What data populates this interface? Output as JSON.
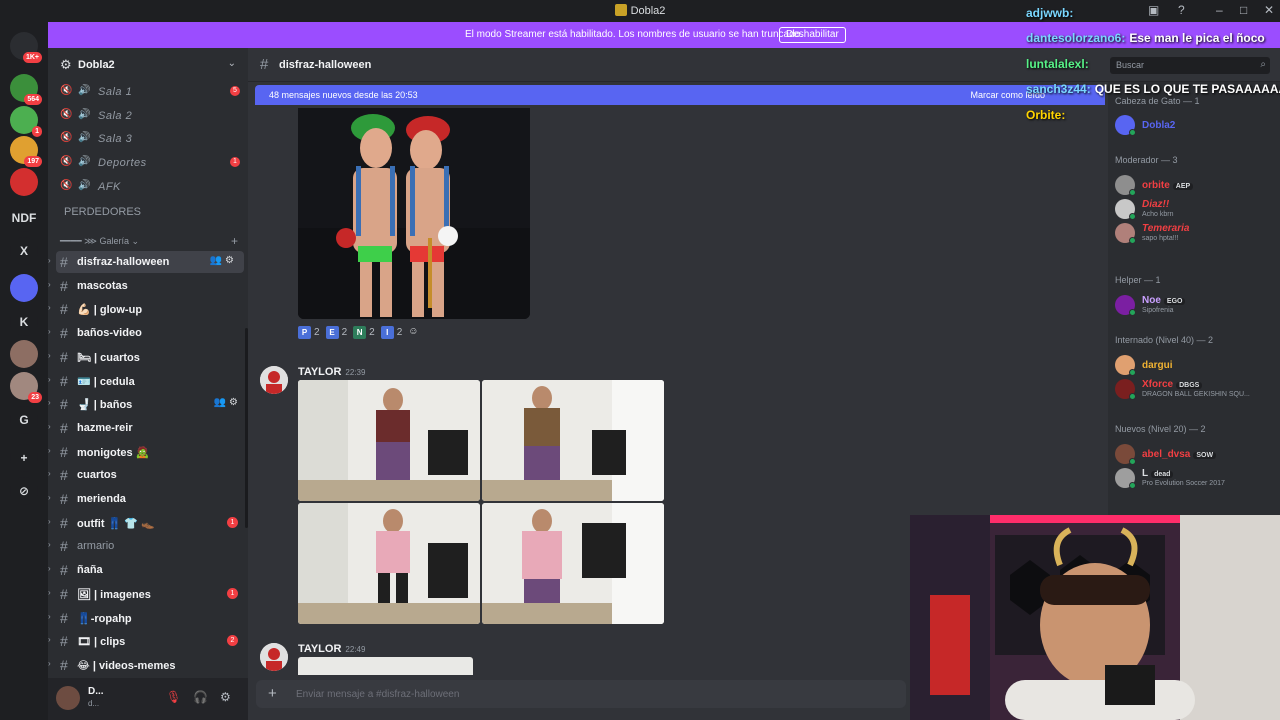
{
  "window": {
    "title": "Dobla2"
  },
  "banner": {
    "text": "El modo Streamer está habilitado. Los nombres de usuario se han truncado.",
    "button": "Deshabilitar"
  },
  "guilds": [
    {
      "label": "",
      "badge": "1K+",
      "color": "#2b2d31"
    },
    {
      "label": "",
      "badge": "564",
      "color": "#3b8f3b"
    },
    {
      "label": "",
      "badge": "1",
      "color": "#4caf50"
    },
    {
      "label": "",
      "badge": "197",
      "color": "#e0a030"
    },
    {
      "label": "",
      "badge": "",
      "color": "#d32f2f"
    },
    {
      "label": "NDF",
      "badge": "",
      "color": "#1e1f22"
    },
    {
      "label": "X",
      "badge": "",
      "color": "#1e1f22"
    },
    {
      "label": "",
      "badge": "",
      "color": "#5865f2"
    },
    {
      "label": "K",
      "badge": "",
      "color": "#1e1f22"
    },
    {
      "label": "",
      "badge": "",
      "color": "#8d6e63"
    },
    {
      "label": "",
      "badge": "23",
      "color": "#a1887f"
    },
    {
      "label": "G",
      "badge": "",
      "color": "#1e1f22"
    },
    {
      "label": "+",
      "badge": "",
      "color": "#1e1f22"
    },
    {
      "label": "⊘",
      "badge": "",
      "color": "#1e1f22"
    }
  ],
  "server": {
    "name": "Dobla2"
  },
  "voice_channels": [
    {
      "label": "Sala 1",
      "badge": "5"
    },
    {
      "label": "Sala 2",
      "badge": ""
    },
    {
      "label": "Sala 3",
      "badge": ""
    },
    {
      "label": "Deportes",
      "badge": "1"
    },
    {
      "label": "AFK",
      "badge": ""
    }
  ],
  "perdedores": "PERDEDORES",
  "category": "━━━━ ⋙ Galería",
  "channels": [
    {
      "label": "disfraz-halloween",
      "badge": "",
      "muted": false,
      "active": true
    },
    {
      "label": "mascotas",
      "badge": "",
      "muted": false
    },
    {
      "label": "💪🏻 | glow-up",
      "badge": "",
      "muted": false
    },
    {
      "label": "baños-video",
      "badge": "",
      "muted": false
    },
    {
      "label": "🛏 | cuartos",
      "badge": "",
      "muted": false
    },
    {
      "label": "🪪 | cedula",
      "badge": "",
      "muted": false
    },
    {
      "label": "🚽 | baños",
      "badge": "",
      "muted": false,
      "hover": true
    },
    {
      "label": "hazme-reir",
      "badge": "",
      "muted": false
    },
    {
      "label": "monigotes 🧟",
      "badge": "",
      "muted": false
    },
    {
      "label": "cuartos",
      "badge": "",
      "muted": false
    },
    {
      "label": "merienda",
      "badge": "",
      "muted": false
    },
    {
      "label": "outfit 👖 👕 👞",
      "badge": "1",
      "muted": false
    },
    {
      "label": "armario",
      "badge": "",
      "muted": true
    },
    {
      "label": "ñaña",
      "badge": "",
      "muted": false
    },
    {
      "label": "🖼 | imagenes",
      "badge": "1",
      "muted": false
    },
    {
      "label": "👖-ropahp",
      "badge": "",
      "muted": false
    },
    {
      "label": "🎞 | clips",
      "badge": "2",
      "muted": false
    },
    {
      "label": "😂 | videos-memes",
      "badge": "",
      "muted": false
    }
  ],
  "user": {
    "name": "D...",
    "status": "d..."
  },
  "channel_header": {
    "name": "disfraz-halloween",
    "search_placeholder": "Buscar"
  },
  "new_messages": {
    "text": "48 mensajes nuevos desde las 20:53",
    "action": "Marcar como leído"
  },
  "reactions": [
    {
      "emoji": "P",
      "color": "#4a6fd8",
      "count": "2"
    },
    {
      "emoji": "E",
      "color": "#4a6fd8",
      "count": "2"
    },
    {
      "emoji": "N",
      "color": "#2e7d5b",
      "count": "2"
    },
    {
      "emoji": "I",
      "color": "#4a6fd8",
      "count": "2"
    }
  ],
  "messages": [
    {
      "author": "TAYLOR",
      "time": "22:39"
    },
    {
      "author": "TAYLOR",
      "time": "22:49"
    }
  ],
  "composer": {
    "placeholder": "Enviar mensaje a #disfraz-halloween"
  },
  "members": {
    "groups": [
      {
        "title": "Cabeza de Gato — 1"
      },
      {
        "title": "Moderador — 3"
      },
      {
        "title": "Helper — 1"
      },
      {
        "title": "Internado (Nivel 40) — 2"
      },
      {
        "title": "Nuevos (Nivel 20) — 2"
      }
    ],
    "list": [
      {
        "name": "Dobla2",
        "tag": "",
        "status": "",
        "color": "#5865f2"
      },
      {
        "name": "orbite",
        "tag": "AEP",
        "status": "",
        "color": "#f23f43"
      },
      {
        "name": "Diaz!!",
        "tag": "",
        "status": "Acho kbrn",
        "color": "#f23f43"
      },
      {
        "name": "Temeraria",
        "tag": "",
        "status": "sapo hpta!!!",
        "color": "#f23f43"
      },
      {
        "name": "Noe",
        "tag": "EGO",
        "status": "Sipofrenia",
        "color": "#c9a0ff"
      },
      {
        "name": "dargui",
        "tag": "",
        "status": "",
        "color": "#f0b232"
      },
      {
        "name": "Xforce",
        "tag": "DBGS",
        "status": "DRAGON BALL GEKISHIN SQU...",
        "color": "#f23f43"
      },
      {
        "name": "abel_dvsa",
        "tag": "SOW",
        "status": "",
        "color": "#f23f43"
      },
      {
        "name": "L",
        "tag": "dead",
        "status": "Pro Evolution Soccer 2017",
        "color": "#dbdee1"
      }
    ]
  },
  "overlay_chat": [
    {
      "user": "adjwwb:",
      "text": ""
    },
    {
      "user": "dantesolorzano6:",
      "text": "Ese man le pica el ñoco"
    },
    {
      "user": "luntalalexl:",
      "text": ""
    },
    {
      "user": "sanch3z44:",
      "text": "QUE ES LO QUE TE PASAAAAAAA"
    },
    {
      "user": "Orbite:",
      "text": ""
    }
  ]
}
